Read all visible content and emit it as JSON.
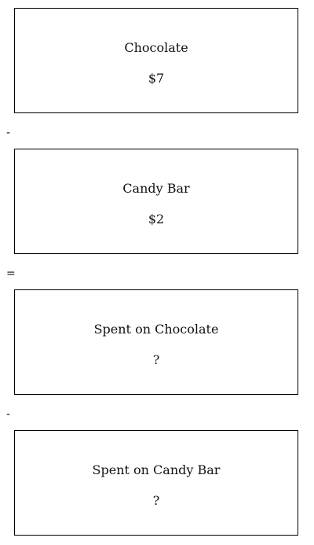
{
  "cards": [
    {
      "label": "Chocolate",
      "value": "$7"
    },
    {
      "label": "Candy Bar",
      "value": "$2"
    },
    {
      "label": "Spent on Chocolate",
      "value": "?"
    },
    {
      "label": "Spent on Candy Bar",
      "value": "?"
    }
  ],
  "operators": [
    "-",
    "=",
    "-"
  ]
}
